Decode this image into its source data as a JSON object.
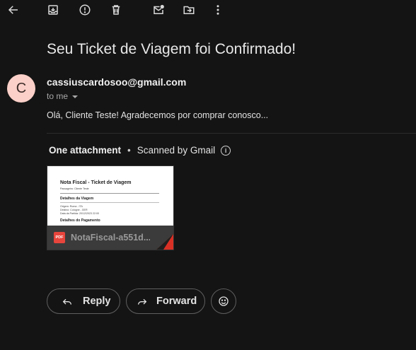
{
  "toolbar": {
    "icons": [
      "back-arrow-icon",
      "archive-icon",
      "report-spam-icon",
      "delete-icon",
      "mark-unread-icon",
      "move-to-icon",
      "more-vert-icon"
    ]
  },
  "email": {
    "subject": "Seu Ticket de Viagem foi Confirmado!",
    "avatar_letter": "C",
    "avatar_color": "#fbd0c8",
    "sender": "cassiuscardosoo@gmail.com",
    "recipient": "to me",
    "snippet": "Olá, Cliente Teste! Agradecemos por comprar conosco..."
  },
  "attachments": {
    "count_label": "One attachment",
    "separator": "•",
    "scanned_label": "Scanned by Gmail",
    "file": {
      "name": "NotaFiscal-a551d...",
      "type_badge": "PDF",
      "preview": {
        "title": "Nota Fiscal - Ticket de Viagem",
        "passenger": "Passageiro: Cliente Teste",
        "section1": "Detalhes da Viagem",
        "lines": [
          "Origem: Roma - ITA",
          "Destino: Cologne - GER",
          "Data da Partida: 20/12/2023 22:00"
        ],
        "section2": "Detalhes do Pagamento"
      }
    }
  },
  "actions": {
    "reply_label": "Reply",
    "forward_label": "Forward"
  }
}
